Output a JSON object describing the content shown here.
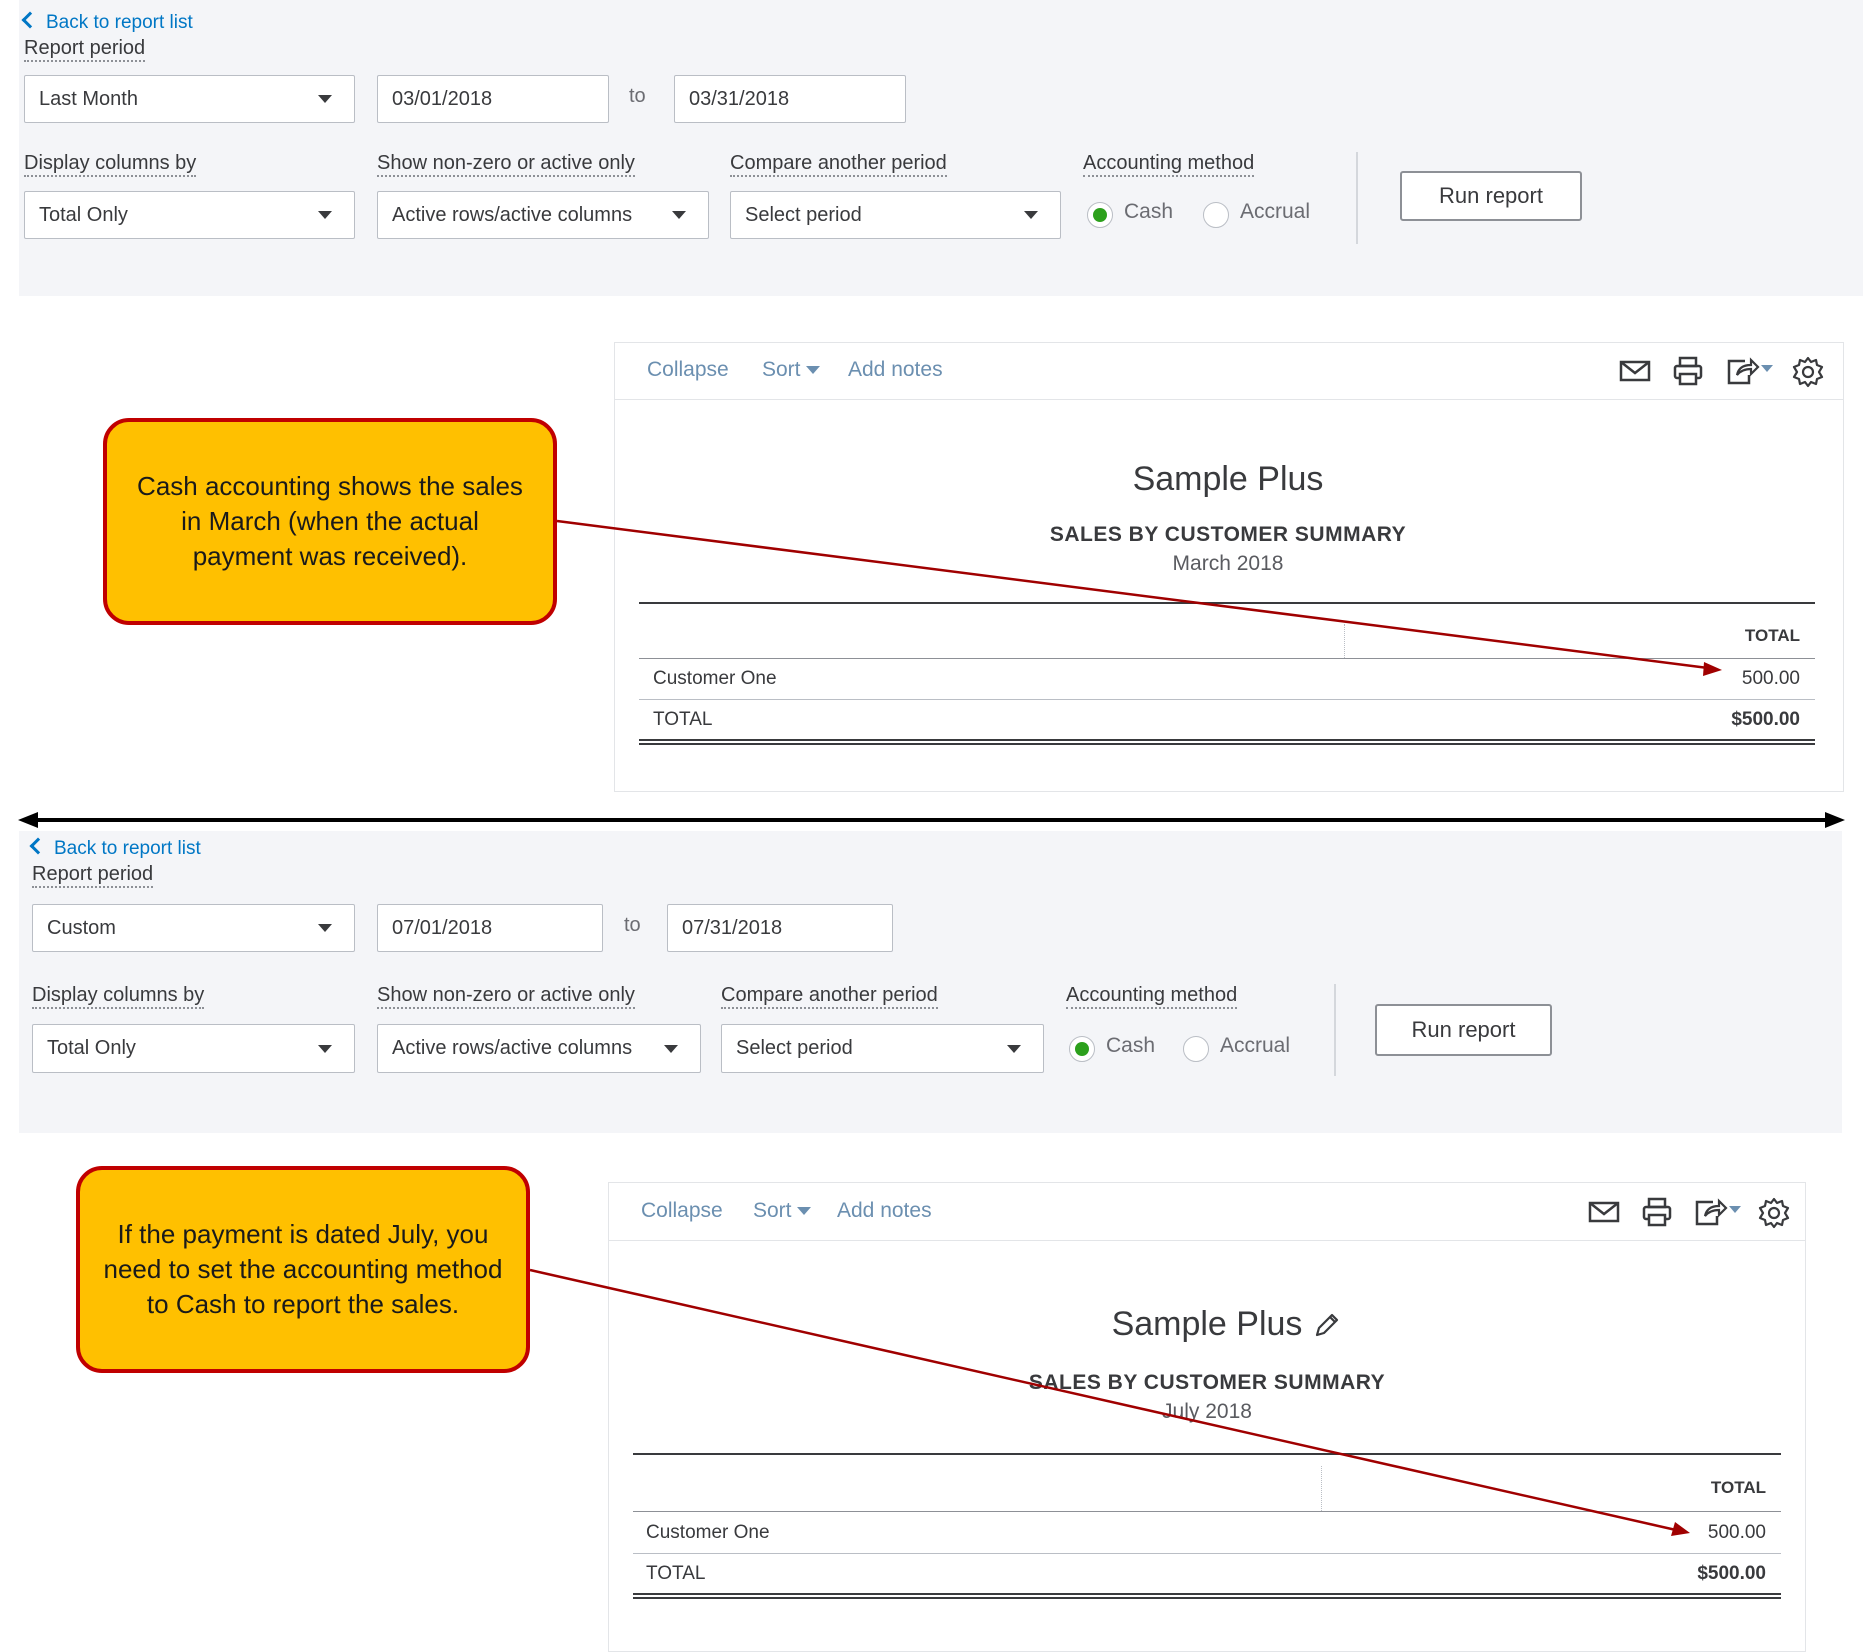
{
  "top": {
    "back_link": "Back to report list",
    "report_period_label": "Report period",
    "period_select": "Last Month",
    "from_date": "03/01/2018",
    "to_label": "to",
    "to_date": "03/31/2018",
    "display_columns_label": "Display columns by",
    "display_columns_value": "Total Only",
    "show_nonzero_label": "Show non-zero or active only",
    "show_nonzero_value": "Active rows/active columns",
    "compare_label": "Compare another period",
    "compare_value": "Select period",
    "accounting_label": "Accounting method",
    "cash_label": "Cash",
    "accrual_label": "Accrual",
    "selected_method": "Cash",
    "run_button": "Run report",
    "toolbar": {
      "collapse": "Collapse",
      "sort": "Sort",
      "add_notes": "Add notes"
    },
    "report": {
      "company": "Sample Plus",
      "title": "SALES BY CUSTOMER SUMMARY",
      "date": "March 2018",
      "column_header": "TOTAL",
      "rows": [
        {
          "name": "Customer One",
          "amount": "500.00"
        }
      ],
      "total_label": "TOTAL",
      "total_amount": "$500.00"
    },
    "callout": "Cash accounting shows the sales in March (when the actual payment was received)."
  },
  "bottom": {
    "back_link": "Back to report list",
    "report_period_label": "Report period",
    "period_select": "Custom",
    "from_date": "07/01/2018",
    "to_label": "to",
    "to_date": "07/31/2018",
    "display_columns_label": "Display columns by",
    "display_columns_value": "Total Only",
    "show_nonzero_label": "Show non-zero or active only",
    "show_nonzero_value": "Active rows/active columns",
    "compare_label": "Compare another period",
    "compare_value": "Select period",
    "accounting_label": "Accounting method",
    "cash_label": "Cash",
    "accrual_label": "Accrual",
    "selected_method": "Cash",
    "run_button": "Run report",
    "toolbar": {
      "collapse": "Collapse",
      "sort": "Sort",
      "add_notes": "Add notes"
    },
    "report": {
      "company": "Sample Plus",
      "title": "SALES BY CUSTOMER SUMMARY",
      "date": "July 2018",
      "column_header": "TOTAL",
      "rows": [
        {
          "name": "Customer One",
          "amount": "500.00"
        }
      ],
      "total_label": "TOTAL",
      "total_amount": "$500.00"
    },
    "callout": "If the payment is dated July, you need to set the accounting method to Cash to report the sales."
  },
  "colors": {
    "callout_fill": "#ffc000",
    "callout_border": "#c00000",
    "arrow": "#a00000",
    "radio_selected": "#2ca01c",
    "link": "#0077c5"
  },
  "icons": [
    "chevron-left-icon",
    "caret-down-icon",
    "mail-icon",
    "print-icon",
    "export-icon",
    "gear-icon",
    "pencil-icon"
  ]
}
